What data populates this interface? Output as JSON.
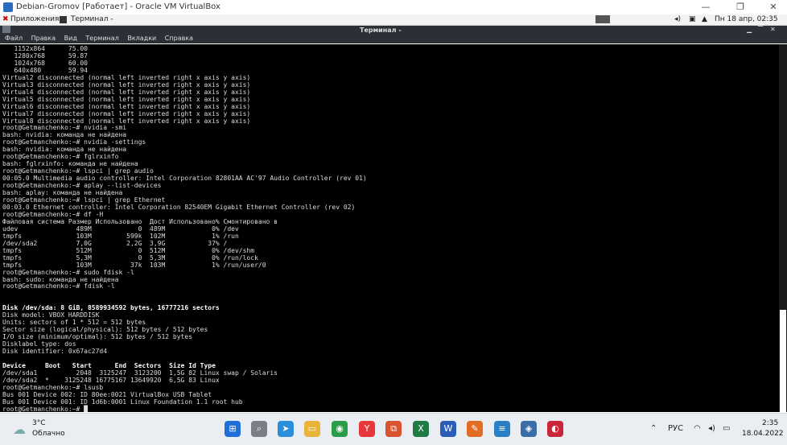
{
  "vbox": {
    "title": "Debian-Gromov [Работает] - Oracle VM VirtualBox",
    "minimize": "—",
    "restore": "❐",
    "close": "✕"
  },
  "guest_panel": {
    "apps_label": "Приложения",
    "terminal_label": "Терминал -",
    "datetime": "Пн 18 апр, 02:35"
  },
  "terminal": {
    "title": "Терминал -",
    "menu": [
      "Файл",
      "Правка",
      "Вид",
      "Терминал",
      "Вкладки",
      "Справка"
    ],
    "lines": [
      "   1152x864      75.00",
      "   1280x768      59.87",
      "   1024x768      60.00",
      "   640x480       59.94",
      "Virtual2 disconnected (normal left inverted right x axis y axis)",
      "Virtual3 disconnected (normal left inverted right x axis y axis)",
      "Virtual4 disconnected (normal left inverted right x axis y axis)",
      "Virtual5 disconnected (normal left inverted right x axis y axis)",
      "Virtual6 disconnected (normal left inverted right x axis y axis)",
      "Virtual7 disconnected (normal left inverted right x axis y axis)",
      "Virtual8 disconnected (normal left inverted right x axis y axis)",
      "root@Getmanchenko:~# nvidia -smi",
      "bash: nvidia: команда не найдена",
      "root@Getmanchenko:~# nvidia -settings",
      "bash: nvidia: команда не найдена",
      "root@Getmanchenko:~# fglrxinfo",
      "bash: fglrxinfo: команда не найдена",
      "root@Getmanchenko:~# lspci | grep audio",
      "00:05.0 Multimedia audio controller: Intel Corporation 82801AA AC'97 Audio Controller (rev 01)",
      "root@Getmanchenko:~# aplay --list-devices",
      "bash: aplay: команда не найдена",
      "root@Getmanchenko:~# lspci | grep Ethernet",
      "00:03.0 Ethernet controller: Intel Corporation 82540EM Gigabit Ethernet Controller (rev 02)",
      "root@Getmanchenko:~# df -H",
      "Файловая система Размер Использовано  Дост Использовано% Смонтировано в",
      "udev               489M            0  489M            0% /dev",
      "tmpfs              103M         599k  102M            1% /run",
      "/dev/sda2          7,0G         2,2G  3,9G           37% /",
      "tmpfs              512M            0  512M            0% /dev/shm",
      "tmpfs              5,3M            0  5,3M            0% /run/lock",
      "tmpfs              103M          37k  103M            1% /run/user/0",
      "root@Getmanchenko:~# sudo fdisk -l",
      "bash: sudo: команда не найдена",
      "root@Getmanchenko:~# fdisk -l",
      "",
      "",
      "Disk /dev/sda: 8 GiB, 8589934592 bytes, 16777216 sectors",
      "Disk model: VBOX HARDDISK",
      "Units: sectors of 1 * 512 = 512 bytes",
      "Sector size (logical/physical): 512 bytes / 512 bytes",
      "I/O size (minimum/optimal): 512 bytes / 512 bytes",
      "Disklabel type: dos",
      "Disk identifier: 0x67ac27d4",
      "",
      "Device     Boot   Start      End  Sectors  Size Id Type",
      "/dev/sda1          2048  3125247  3123200  1,5G 82 Linux swap / Solaris",
      "/dev/sda2  *    3125248 16775167 13649920  6,5G 83 Linux",
      "root@Getmanchenko:~# lsusb",
      "Bus 001 Device 002: ID 80ee:0021 VirtualBox USB Tablet",
      "Bus 001 Device 001: ID 1d6b:0001 Linux Foundation 1.1 root hub",
      "root@Getmanchenko:~# █"
    ]
  },
  "taskbar": {
    "temperature": "3°C",
    "weather": "Облачно",
    "language": "РУС",
    "time": "2:35",
    "date": "18.04.2022"
  }
}
